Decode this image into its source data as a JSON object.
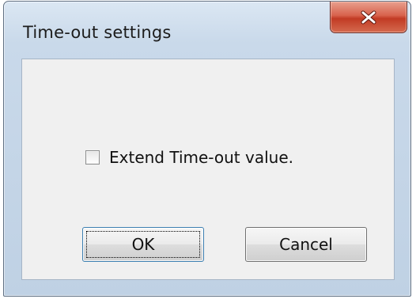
{
  "dialog": {
    "title": "Time-out settings",
    "close_icon": "close-icon",
    "checkbox": {
      "label": "Extend Time-out value.",
      "checked": false
    },
    "buttons": {
      "ok_label": "OK",
      "cancel_label": "Cancel"
    },
    "colors": {
      "close_button": "#c23b24",
      "frame": "#bfd1e4",
      "client": "#f0f0f0"
    }
  }
}
